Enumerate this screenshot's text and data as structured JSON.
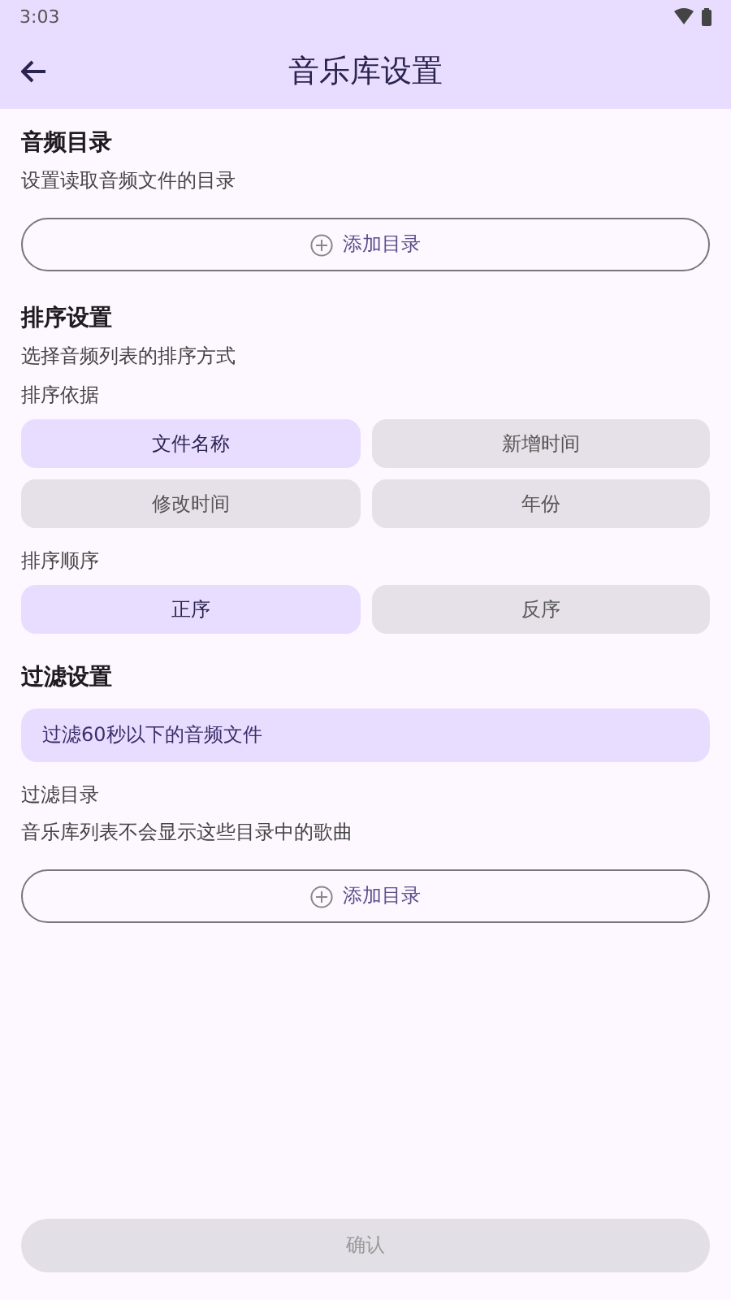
{
  "status_bar": {
    "time": "3:03"
  },
  "app_bar": {
    "title": "音乐库设置"
  },
  "audio_dir": {
    "title": "音频目录",
    "subtitle": "设置读取音频文件的目录",
    "add_button": "添加目录"
  },
  "sort": {
    "title": "排序设置",
    "subtitle": "选择音频列表的排序方式",
    "by_label": "排序依据",
    "by_options": [
      {
        "label": "文件名称",
        "selected": true
      },
      {
        "label": "新增时间",
        "selected": false
      },
      {
        "label": "修改时间",
        "selected": false
      },
      {
        "label": "年份",
        "selected": false
      }
    ],
    "order_label": "排序顺序",
    "order_options": [
      {
        "label": "正序",
        "selected": true
      },
      {
        "label": "反序",
        "selected": false
      }
    ]
  },
  "filter": {
    "title": "过滤设置",
    "short_filter": {
      "label": "过滤60秒以下的音频文件",
      "selected": true
    },
    "dir_title": "过滤目录",
    "dir_subtitle": "音乐库列表不会显示这些目录中的歌曲",
    "add_button": "添加目录"
  },
  "confirm": {
    "label": "确认",
    "disabled": true
  }
}
